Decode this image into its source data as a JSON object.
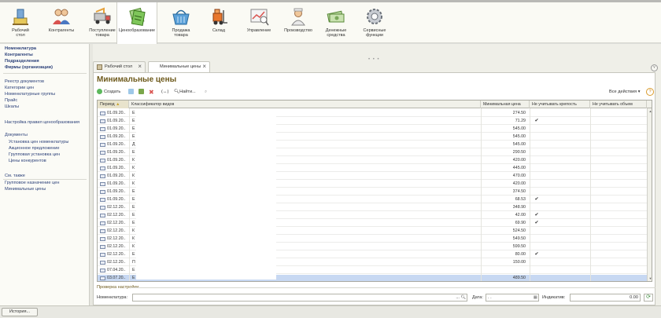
{
  "sections": [
    {
      "label": "Рабочий\nстол",
      "icon": "desktop-icon"
    },
    {
      "label": "Контрагенты",
      "icon": "people-icon"
    },
    {
      "label": "Поступление\nтовара",
      "icon": "truck-icon"
    },
    {
      "label": "Ценообразование",
      "icon": "price-tags-icon",
      "active": true
    },
    {
      "label": "Продажа\nтовара",
      "icon": "basket-icon"
    },
    {
      "label": "Склад",
      "icon": "forklift-icon"
    },
    {
      "label": "Управление",
      "icon": "chart-icon"
    },
    {
      "label": "Производство",
      "icon": "worker-icon"
    },
    {
      "label": "Денежные\nсредства",
      "icon": "money-icon"
    },
    {
      "label": "Сервисные\nфункции",
      "icon": "gear-icon"
    }
  ],
  "sidebar": {
    "primary": [
      "Номенклатура",
      "Контрагенты",
      "Подразделения",
      "Фирмы (организации)"
    ],
    "links1": [
      "Реестр документов",
      "Категории цен",
      "Номенклатурные группы",
      "Прайс",
      "Шкалы"
    ],
    "link2": "Настройка правил ценообразования",
    "documents_header": "Документы",
    "documents": [
      "Установка цен номенклатуры",
      "Акционное предложение",
      "Групповая установка цен",
      "Цены конкурентов"
    ],
    "see_also_header": "См. также",
    "see_also": [
      "Групповое назначение цен",
      "Минимальные цены"
    ]
  },
  "tabs": [
    {
      "label": "Рабочий стол"
    },
    {
      "label": "Минимальные цены",
      "active": true
    }
  ],
  "form": {
    "title": "Минимальные цены",
    "create_label": "Создать",
    "find_label": "Найти...",
    "all_actions_label": "Все действия",
    "help_label": "?",
    "columns": [
      "Период",
      "Классификатор видов",
      "Минимальная цена",
      "Не учитывать крепость",
      "Не учитывать объем"
    ],
    "rows": [
      {
        "period": "01.09.20..",
        "cls": "Е",
        "price": "274.50",
        "check": ""
      },
      {
        "period": "01.09.20..",
        "cls": "Е",
        "price": "71.29",
        "check": "✔"
      },
      {
        "period": "01.09.20..",
        "cls": "Е",
        "price": "545.00",
        "check": ""
      },
      {
        "period": "01.09.20..",
        "cls": "Е",
        "price": "545.00",
        "check": ""
      },
      {
        "period": "01.09.20..",
        "cls": "Д",
        "price": "545.00",
        "check": ""
      },
      {
        "period": "01.09.20..",
        "cls": "Е",
        "price": "290.50",
        "check": ""
      },
      {
        "period": "01.09.20..",
        "cls": "К",
        "price": "420.00",
        "check": ""
      },
      {
        "period": "01.09.20..",
        "cls": "К",
        "price": "445.00",
        "check": ""
      },
      {
        "period": "01.09.20..",
        "cls": "К",
        "price": "470.00",
        "check": ""
      },
      {
        "period": "01.09.20..",
        "cls": "К",
        "price": "420.00",
        "check": ""
      },
      {
        "period": "01.09.20..",
        "cls": "Е",
        "price": "374.50",
        "check": ""
      },
      {
        "period": "01.09.20..",
        "cls": "Е",
        "price": "68.53",
        "check": "✔"
      },
      {
        "period": "02.12.20..",
        "cls": "Е",
        "price": "348.90",
        "check": ""
      },
      {
        "period": "02.12.20..",
        "cls": "Е",
        "price": "42.00",
        "check": "✔"
      },
      {
        "period": "02.12.20..",
        "cls": "Е",
        "price": "69.90",
        "check": "✔"
      },
      {
        "period": "02.12.20..",
        "cls": "К",
        "price": "524.50",
        "check": ""
      },
      {
        "period": "02.12.20..",
        "cls": "К",
        "price": "549.50",
        "check": ""
      },
      {
        "period": "02.12.20..",
        "cls": "К",
        "price": "599.50",
        "check": ""
      },
      {
        "period": "02.12.20..",
        "cls": "Е",
        "price": "80.00",
        "check": "✔"
      },
      {
        "period": "02.12.20..",
        "cls": "П",
        "price": "150.00",
        "check": ""
      },
      {
        "period": "07.04.20..",
        "cls": "Е",
        "price": "",
        "check": ""
      },
      {
        "period": "03.07.20..",
        "cls": "Е",
        "price": "489.50",
        "check": "",
        "selected": true
      }
    ]
  },
  "check": {
    "title": "Проверка настройки",
    "nomenclature_label": "Номенклатура:",
    "nomenclature_value": "",
    "date_label": "Дата:",
    "date_value": "  .  .",
    "indicator_label": "Индикатив:",
    "indicator_value": "0.00"
  },
  "statusbar": {
    "history_label": "История..."
  },
  "colors": {
    "title": "#6e5a1c",
    "selection": "#c7d8f2",
    "link": "#2a3f78"
  }
}
